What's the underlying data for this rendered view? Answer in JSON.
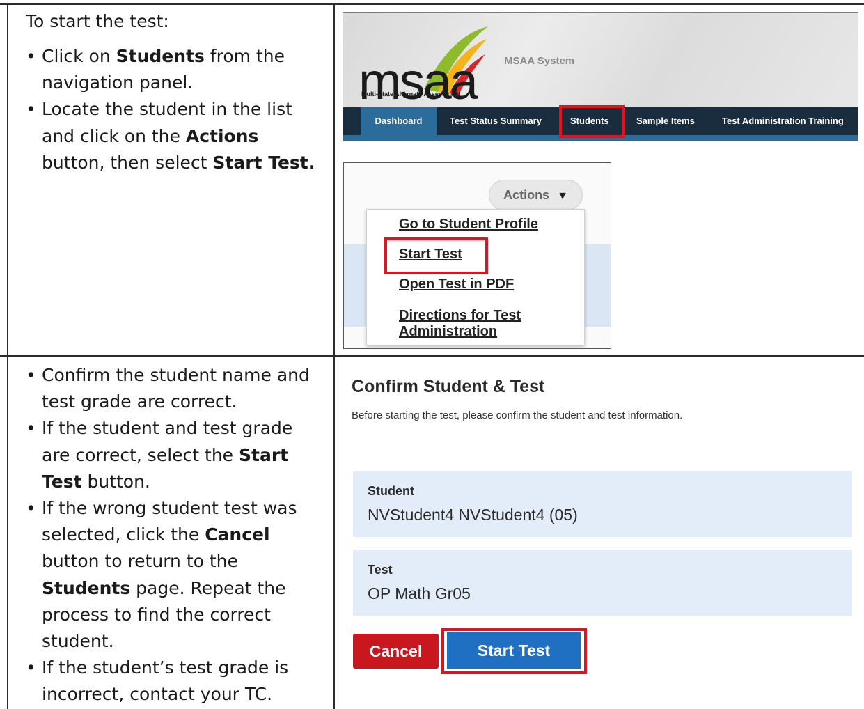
{
  "left_cells": {
    "top": {
      "intro": "To start the test:",
      "bullet1": {
        "pre": "Click on ",
        "bold": "Students",
        "post": " from the navigation panel."
      },
      "bullet2": {
        "pre": "Locate the student in the list and click on the ",
        "bold1": "Actions",
        "mid": " button, then select ",
        "bold2": "Start Test."
      }
    },
    "bottom": {
      "bullet1": "Confirm the student name and test grade are correct.",
      "bullet2": {
        "pre": "If the student and test grade are correct, select the ",
        "bold": "Start Test",
        "post": " button."
      },
      "bullet3": {
        "pre": "If the wrong student test was selected, click the ",
        "bold1": "Cancel",
        "mid": " button to return to the ",
        "bold2": "Students",
        "post": " page. Repeat the process to find the correct student."
      },
      "bullet4": "If the student’s test grade is incorrect, contact your TC."
    }
  },
  "msaa_header": {
    "logo_text": "msaa",
    "logo_subtitle": "Multi-State Alternate Assessment",
    "system_name": "MSAA System",
    "nav": [
      "Dashboard",
      "Test Status Summary",
      "Students",
      "Sample Items",
      "Test Administration Training"
    ],
    "highlighted_nav": "Students"
  },
  "actions_menu": {
    "button_label": "Actions",
    "items": [
      "Go to Student Profile",
      "Start Test",
      "Open Test in PDF",
      "Directions for Test",
      "Administration"
    ],
    "highlighted_item": "Start Test"
  },
  "confirm": {
    "title": "Confirm Student & Test",
    "description": "Before starting the test, please confirm the student and test information.",
    "student_label": "Student",
    "student_value": "NVStudent4 NVStudent4 (05)",
    "test_label": "Test",
    "test_value": "OP Math Gr05",
    "cancel_label": "Cancel",
    "start_label": "Start Test"
  },
  "colors": {
    "highlight": "#e0141e",
    "nav_bg": "#1a2d3e",
    "cancel": "#c8171e",
    "start": "#1f6fc3",
    "info_bg": "#e3edfa"
  }
}
